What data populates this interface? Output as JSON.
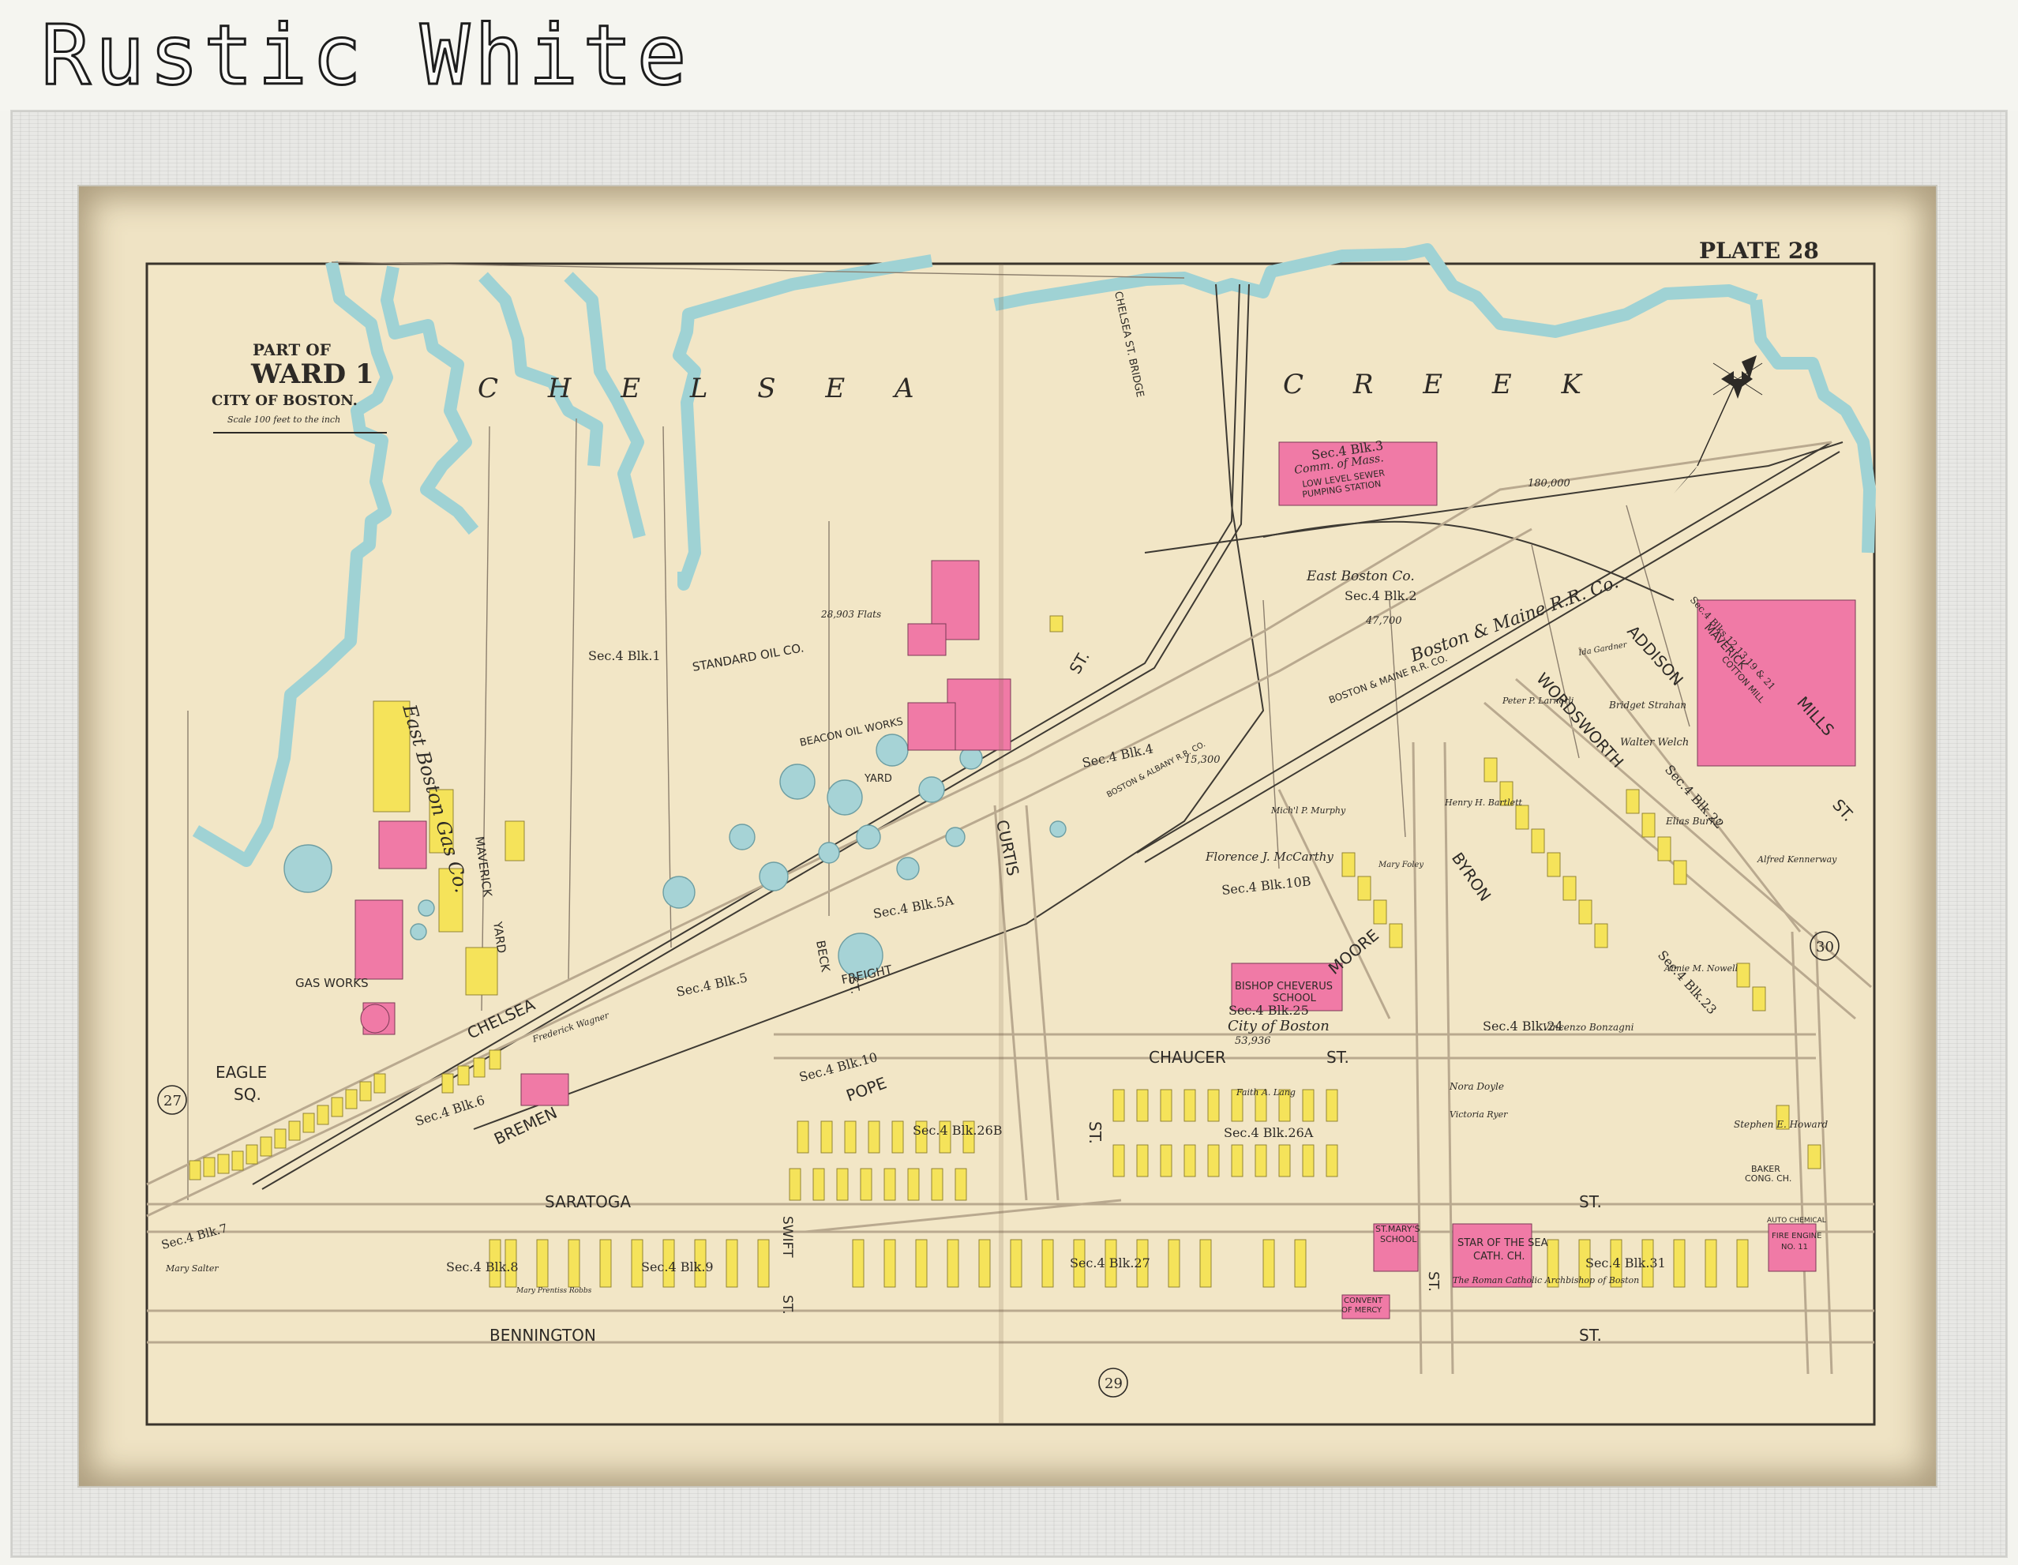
{
  "banner": {
    "title": "Rustic White"
  },
  "map": {
    "plate": "PLATE 28",
    "title": {
      "line1": "PART OF",
      "line2": "WARD 1",
      "line3": "CITY OF BOSTON.",
      "scale": "Scale 100 feet to the inch"
    },
    "water": {
      "chelsea": "C H E L S E A",
      "creek": "C R E E K",
      "bridge": "CHELSEA ST. BRIDGE"
    },
    "streets": {
      "chelsea": "CHELSEA",
      "bremen": "BREMEN",
      "pope": "POPE",
      "saratoga": "SARATOGA",
      "bennington": "BENNINGTON",
      "bennington_st": "ST.",
      "chaucer": "CHAUCER",
      "chaucer_st": "ST.",
      "curtis": "CURTIS",
      "curtis_st": "ST.",
      "moore": "MOORE",
      "byron": "BYRON",
      "wordsworth": "WORDSWORTH",
      "addison": "ADDISON",
      "addison_st": "ST.",
      "swift": "SWIFT",
      "swift_st": "ST.",
      "beck": "BECK",
      "beck_st": "ST.",
      "chelsea_st": "ST.",
      "saratoga_st": "ST.",
      "st_generic": "ST.",
      "eagle_sq1": "EAGLE",
      "eagle_sq2": "SQ.",
      "freight": "FREIGHT",
      "railroad": "BOSTON & MAINE R.R. CO.",
      "boston_maine": "Boston & Maine R.R. Co.",
      "boston_albany": "BOSTON & ALBANY R.R. CO."
    },
    "places": {
      "gas_works": "GAS WORKS",
      "boston_gas": "East Boston Gas Co.",
      "maverick_yard1": "MAVERICK",
      "maverick_yard2": "YARD",
      "standard_oil": "STANDARD  OIL  CO.",
      "beacon_oil": "BEACON OIL WORKS",
      "beacon_yard": "YARD",
      "pumping1": "LOW LEVEL SEWER",
      "pumping2": "PUMPING STATION",
      "pumping_owner": "Comm. of Mass.",
      "east_boston_co": "East Boston Co.",
      "bishop_cheverus1": "BISHOP CHEVERUS",
      "bishop_cheverus2": "SCHOOL",
      "city_of_boston": "City of Boston",
      "maverick_mills1": "MAVERICK",
      "maverick_mills2": "MILLS",
      "maverick_mills3": "COTTON MILL",
      "star_of_sea1": "STAR OF THE SEA",
      "star_of_sea2": "CATH. CH.",
      "roman_catholic": "The Roman Catholic Archbishop of Boston",
      "st_marys1": "ST.MARY'S",
      "st_marys2": "SCHOOL",
      "convent1": "CONVENT",
      "convent2": "OF MERCY",
      "fire_engine1": "AUTO CHEMICAL",
      "fire_engine2": "FIRE ENGINE",
      "fire_engine3": "NO. 11",
      "baker_church1": "BAKER",
      "baker_church2": "CONG. CH."
    },
    "blocks": {
      "b1": "Sec.4 Blk.1",
      "b2": "Sec.4 Blk.2",
      "b3": "Sec.4 Blk.3",
      "b4": "Sec.4 Blk.4",
      "b5": "Sec.4 Blk.5",
      "b5a": "Sec.4 Blk.5A",
      "b6": "Sec.4 Blk.6",
      "b7": "Sec.4 Blk.7",
      "b8": "Sec.4 Blk.8",
      "b9": "Sec.4 Blk.9",
      "b10": "Sec.4 Blk.10",
      "b10b": "Sec.4 Blk.10B",
      "b12": "Sec.4 Blks.12,13,19 & 21",
      "b22": "Sec.4 Blk.22",
      "b23": "Sec.4 Blk.23",
      "b24": "Sec.4 Blk.24",
      "b25": "Sec.4 Blk.25",
      "b26a": "Sec.4 Blk.26A",
      "b26b": "Sec.4 Blk.26B",
      "b27": "Sec.4 Blk.27",
      "b31": "Sec.4 Blk.31"
    },
    "areas": {
      "a180000": "180,000",
      "a47700": "47,700",
      "a28903": "28,903 Flats",
      "a53936": "53,936",
      "a15300": "15,300"
    },
    "adjacent_plates": {
      "p27": "27",
      "p29": "29",
      "p30": "30"
    },
    "owners": {
      "o1": "Florence J. McCarthy",
      "o2": "Mich'l P. Murphy",
      "o3": "Walter Welch",
      "o4": "Bridget Strahan",
      "o5": "Vincenzo Bonzagni",
      "o6": "Henry H. Bartlett",
      "o7": "Elias Burke",
      "o8": "Alfred Kennerway",
      "o9": "Nora Doyle",
      "o10": "Victoria Ryer",
      "o11": "Annie M. Nowell",
      "o12": "Mary Salter",
      "o13": "Stephen E. Howard",
      "o14": "Frederick Wagner",
      "o15": "Mary Prentiss Robbs",
      "o16": "Ida Gardner",
      "o17": "Faith A. Lang",
      "o18": "Peter P. Larnorli",
      "o19": "Mary Foley"
    },
    "colors": {
      "paper": "#f2e6c6",
      "water": "#a9d6d6",
      "brick": "#f07aa6",
      "wood": "#f5e35a",
      "ink": "#2d2a26"
    }
  }
}
